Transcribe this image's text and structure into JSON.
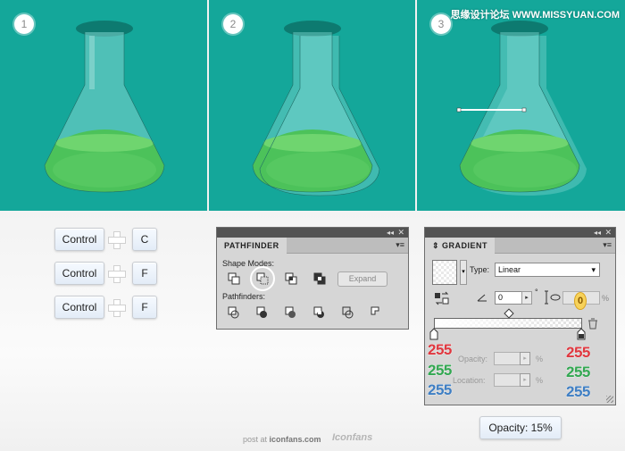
{
  "steps": [
    {
      "number": "1"
    },
    {
      "number": "2"
    },
    {
      "number": "3"
    }
  ],
  "watermark": "思缘设计论坛 WWW.MISSYUAN.COM",
  "shortcuts": [
    {
      "modifier": "Control",
      "key": "C"
    },
    {
      "modifier": "Control",
      "key": "F"
    },
    {
      "modifier": "Control",
      "key": "F"
    }
  ],
  "pathfinder": {
    "title": "PATHFINDER",
    "shape_modes_label": "Shape Modes:",
    "pathfinders_label": "Pathfinders:",
    "expand_label": "Expand"
  },
  "gradient": {
    "title": "GRADIENT",
    "type_label": "Type:",
    "type_value": "Linear",
    "angle_value": "0",
    "degree_symbol": "°",
    "aspect_value": "0",
    "percent": "%",
    "opacity_label": "Opacity:",
    "location_label": "Location:",
    "left_stop_rgb": [
      "255",
      "255",
      "255"
    ],
    "right_stop_rgb": [
      "255",
      "255",
      "255"
    ]
  },
  "opacity_note": "Opacity: 15%",
  "footer": {
    "post_text": "post at",
    "site": "iconfans.com",
    "logo": "Iconfans"
  },
  "colors": {
    "teal_bg": "#14a79a",
    "red": "#e03840",
    "green": "#33a852",
    "blue": "#3f7fc4"
  }
}
